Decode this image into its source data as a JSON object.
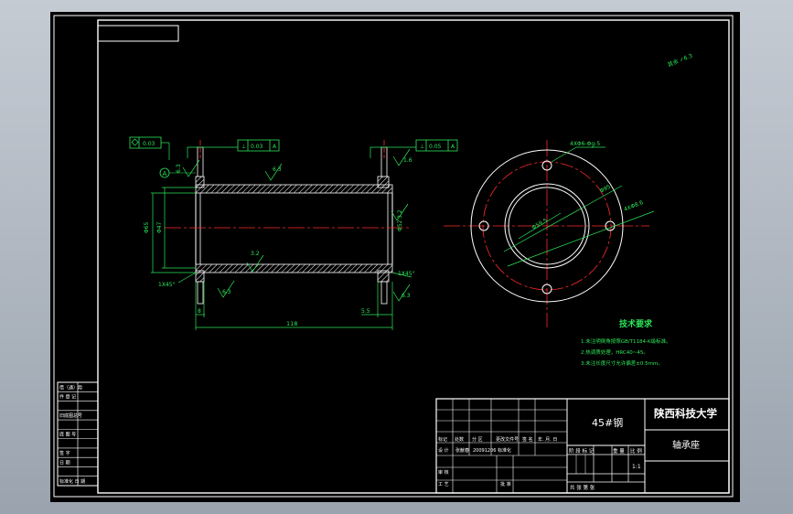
{
  "colors": {
    "background": "#000000",
    "frame": "#ffffff",
    "dimension": "#2de65a",
    "centerline": "#ff2a2a",
    "title_text": "#ffffff"
  },
  "drawing": {
    "surface_finish_rest": "其余 ✓6.3",
    "left_view": {
      "gdt_left_value": "0.03",
      "gdt_left_datum": "A",
      "gdt_right_value": "0.05",
      "gdt_right_datum": "A",
      "flatness_value": "0.03",
      "datum_label": "A",
      "dims": {
        "total_length": "118",
        "flange_left": "8",
        "flange_right": "5.5",
        "chamfer_left": "1X45°",
        "chamfer_right": "1X45°",
        "dia_outer": "Φ65",
        "dia_inner": "Φ47",
        "dia_right": "Φ52"
      },
      "roughness": {
        "r1": "6.3",
        "r2": "3.2",
        "r3": "6.3",
        "r4": "1.6",
        "r5": "6.3",
        "r6": "6.3",
        "r7": "3.2"
      }
    },
    "right_view": {
      "holes_label": "4XΦ6-Φg-5",
      "dia_bolt_circle": "Φ95",
      "dia_hole": "4XΦ8.6",
      "dia_bore": "Φ59.5"
    },
    "tech_requirements": {
      "title": "技术要求",
      "items": [
        "1.未注明倒角按照GB/T1184-K级标准。",
        "2.热调质处理，HRC40~45。",
        "3.未注长度尺寸允许偏差±0.5mm。"
      ]
    }
  },
  "left_side_table": [
    "借（通）用",
    "件 登 记",
    "",
    "旧底图总号",
    "",
    "底 图 号",
    "",
    "签   字",
    "日   期",
    "",
    "标准化 日 期"
  ],
  "title_block": {
    "material": "45#钢",
    "school": "陕西科技大学",
    "part_name": "轴承座",
    "scale": "1:1",
    "labels": {
      "mark": "标记",
      "count": "处数",
      "zone": "分 区",
      "change_doc": "更改文件号",
      "signature": "签 名",
      "date": "年. 月. 日",
      "design": "设 计",
      "designer": "张献春",
      "design_date": "20091206",
      "standardize": "标准化",
      "stage_mark": "阶 段 标 记",
      "weight": "重 量",
      "scale_label": "比 例",
      "review": "审 核",
      "process": "工 艺",
      "approve": "批 准",
      "sheet": "共   张   第   张"
    }
  }
}
